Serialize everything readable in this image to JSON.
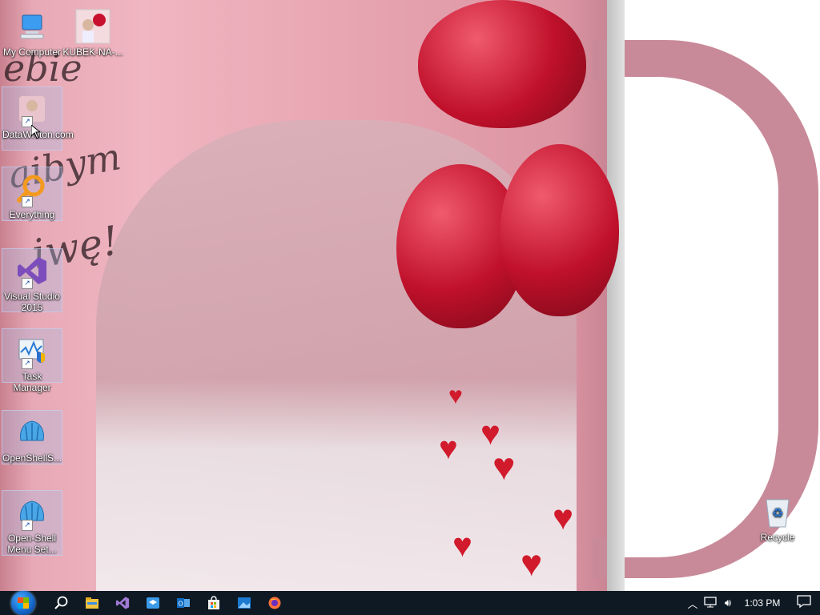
{
  "desktop": {
    "icons": [
      {
        "label": "My Computer",
        "icon": "computer-icon"
      },
      {
        "label": "KUBEK-NA-...",
        "icon": "image-file-icon"
      },
      {
        "label": "DataWhiton.com",
        "icon": "datawhiton-shortcut-icon"
      },
      {
        "label": "Everything",
        "icon": "everything-search-icon"
      },
      {
        "label": "Visual Studio 2015",
        "icon": "visual-studio-icon"
      },
      {
        "label": "Task Manager",
        "icon": "task-manager-icon"
      },
      {
        "label": "OpenShellS...",
        "icon": "openshell-icon"
      },
      {
        "label": "Open-Shell Menu Set...",
        "icon": "openshell-settings-icon"
      },
      {
        "label": "Recycle",
        "icon": "recycle-bin-icon"
      }
    ],
    "wallpaper": {
      "script_lines": [
        "ebie",
        "aibym",
        "iwę!"
      ]
    }
  },
  "taskbar": {
    "clock": "1:03 PM",
    "pinned": [
      "search-icon",
      "file-explorer-icon",
      "visual-studio-icon",
      "store-app-icon",
      "outlook-icon",
      "store-bag-icon",
      "photos-icon",
      "firefox-icon"
    ]
  },
  "colors": {
    "taskbar": "#0f1923",
    "accent": "#1464c8",
    "mug": "#c88a99"
  }
}
